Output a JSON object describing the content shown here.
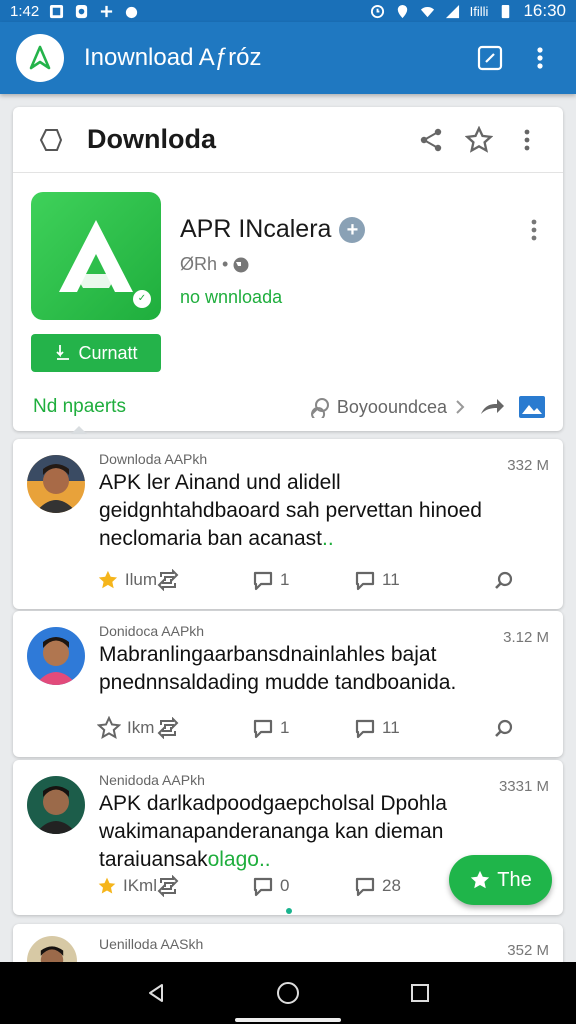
{
  "status_bar": {
    "time_left": "1:42",
    "carrier": "Ifilli",
    "time_right": "16:30"
  },
  "app_bar": {
    "title": "Inownload Aƒróz",
    "logo_icon": "download-arrow-icon",
    "edit_icon": "edit-icon",
    "more_icon": "more-vert-icon"
  },
  "detail": {
    "title": "Downloda",
    "app_name": "APR INcalera",
    "meta": "ØRh •",
    "status": "no wnnloada",
    "action_label": "Curnatt",
    "tab_active": "Nd npaerts",
    "search_label": "Boyooundcea"
  },
  "posts": [
    {
      "source": "Downloda AAPkh",
      "time": "332 M",
      "text": "APK ler Ainand und alidell geidgnhtahdbaoard sah pervettan hinoed neclomaria ban acanast",
      "highlight": "..",
      "like_label": "Ilum",
      "comment_count": "1",
      "share_count": "11"
    },
    {
      "source": "Donidoca AAPkh",
      "time": "3.12 M",
      "text": "Mabranlingaarbansdnainlahles bajat pnednnsaldading mudde tandboanida.",
      "highlight": "",
      "like_label": "Ikm",
      "comment_count": "1",
      "share_count": "11"
    },
    {
      "source": "Nenidoda AAPkh",
      "time": "3331 M",
      "text": "APK darlkadpoodgaepcholsal Dpohla wakimanapanderananga kan dieman taraiuansak",
      "highlight": "olago..",
      "like_label": "IKml",
      "comment_count": "0",
      "share_count": "28"
    }
  ],
  "peek": {
    "source": "Uenilloda AASkh",
    "time": "352 M"
  },
  "fab": {
    "label": "The"
  },
  "colors": {
    "primary": "#1f78c1",
    "accent_green": "#24b34a",
    "star": "#f5b51b"
  }
}
